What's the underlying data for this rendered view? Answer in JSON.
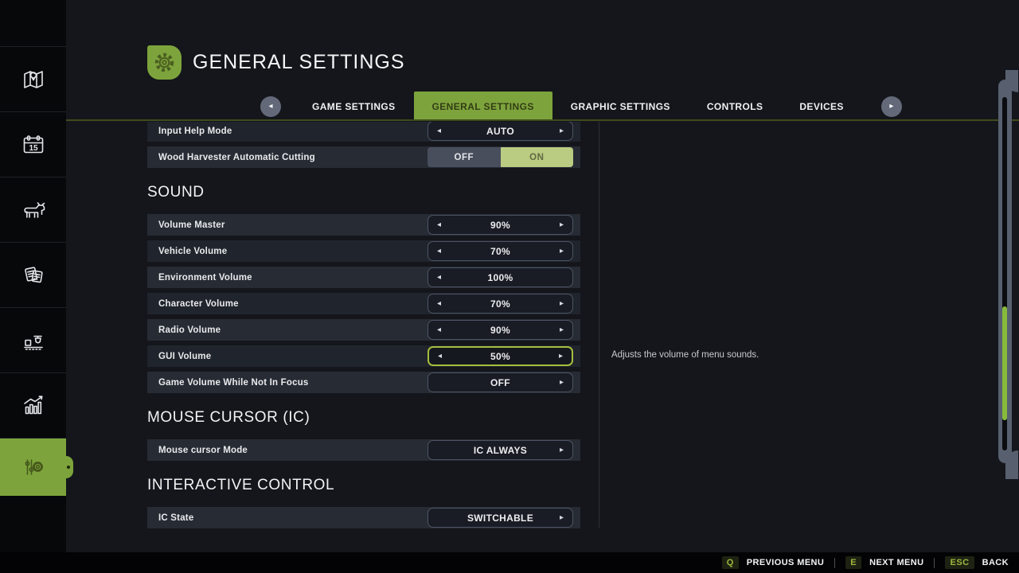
{
  "colors": {
    "accent_green": "#7da43c",
    "toggle_on_bg": "#bacb82",
    "focus_border": "#a3bf3e",
    "scrollbar_thumb": "#87ba3b",
    "key_hint_text": "#9cb83e"
  },
  "sidebar": {
    "calendar_day": "15",
    "items": [
      {
        "name": "map",
        "active": false
      },
      {
        "name": "calendar",
        "active": false
      },
      {
        "name": "animals",
        "active": false
      },
      {
        "name": "contracts",
        "active": false
      },
      {
        "name": "production",
        "active": false
      },
      {
        "name": "statistics",
        "active": false
      },
      {
        "name": "settings",
        "active": true
      }
    ]
  },
  "header": {
    "title": "GENERAL SETTINGS"
  },
  "tabs": {
    "prev": "◂",
    "next": "▸",
    "items": [
      {
        "label": "GAME SETTINGS",
        "active": false
      },
      {
        "label": "GENERAL SETTINGS",
        "active": true
      },
      {
        "label": "GRAPHIC SETTINGS",
        "active": false
      },
      {
        "label": "CONTROLS",
        "active": false
      },
      {
        "label": "DEVICES",
        "active": false
      }
    ]
  },
  "settings": {
    "arrow_left": "◂",
    "arrow_right": "▸",
    "items": [
      {
        "type": "row",
        "label": "Input Help Mode",
        "control": "selector",
        "value": "AUTO",
        "left_arrow": true,
        "right_arrow": true,
        "stripe": "dark",
        "clipped": true
      },
      {
        "type": "row",
        "label": "Wood Harvester Automatic Cutting",
        "control": "toggle",
        "options": [
          "OFF",
          "ON"
        ],
        "value": "ON",
        "stripe": "light"
      },
      {
        "type": "header",
        "label": "SOUND"
      },
      {
        "type": "row",
        "label": "Volume Master",
        "control": "selector",
        "value": "90%",
        "left_arrow": true,
        "right_arrow": true,
        "stripe": "light"
      },
      {
        "type": "row",
        "label": "Vehicle Volume",
        "control": "selector",
        "value": "70%",
        "left_arrow": true,
        "right_arrow": true,
        "stripe": "dark"
      },
      {
        "type": "row",
        "label": "Environment Volume",
        "control": "selector",
        "value": "100%",
        "left_arrow": true,
        "right_arrow": false,
        "stripe": "light"
      },
      {
        "type": "row",
        "label": "Character Volume",
        "control": "selector",
        "value": "70%",
        "left_arrow": true,
        "right_arrow": true,
        "stripe": "dark"
      },
      {
        "type": "row",
        "label": "Radio Volume",
        "control": "selector",
        "value": "90%",
        "left_arrow": true,
        "right_arrow": true,
        "stripe": "light"
      },
      {
        "type": "row",
        "label": "GUI Volume",
        "control": "selector",
        "value": "50%",
        "left_arrow": true,
        "right_arrow": true,
        "stripe": "dark",
        "focused": true
      },
      {
        "type": "row",
        "label": "Game Volume While Not In Focus",
        "control": "selector",
        "value": "OFF",
        "left_arrow": false,
        "right_arrow": true,
        "stripe": "light"
      },
      {
        "type": "header",
        "label": "MOUSE CURSOR (IC)"
      },
      {
        "type": "row",
        "label": "Mouse cursor Mode",
        "control": "selector",
        "value": "IC ALWAYS",
        "left_arrow": false,
        "right_arrow": true,
        "stripe": "light"
      },
      {
        "type": "header",
        "label": "INTERACTIVE CONTROL"
      },
      {
        "type": "row",
        "label": "IC State",
        "control": "selector",
        "value": "SWITCHABLE",
        "left_arrow": false,
        "right_arrow": true,
        "stripe": "light"
      }
    ]
  },
  "help": {
    "text": "Adjusts the volume of menu sounds."
  },
  "footer": {
    "items": [
      {
        "key": "Q",
        "label": "PREVIOUS MENU"
      },
      {
        "key": "E",
        "label": "NEXT MENU"
      },
      {
        "key": "ESC",
        "label": "BACK"
      }
    ]
  }
}
